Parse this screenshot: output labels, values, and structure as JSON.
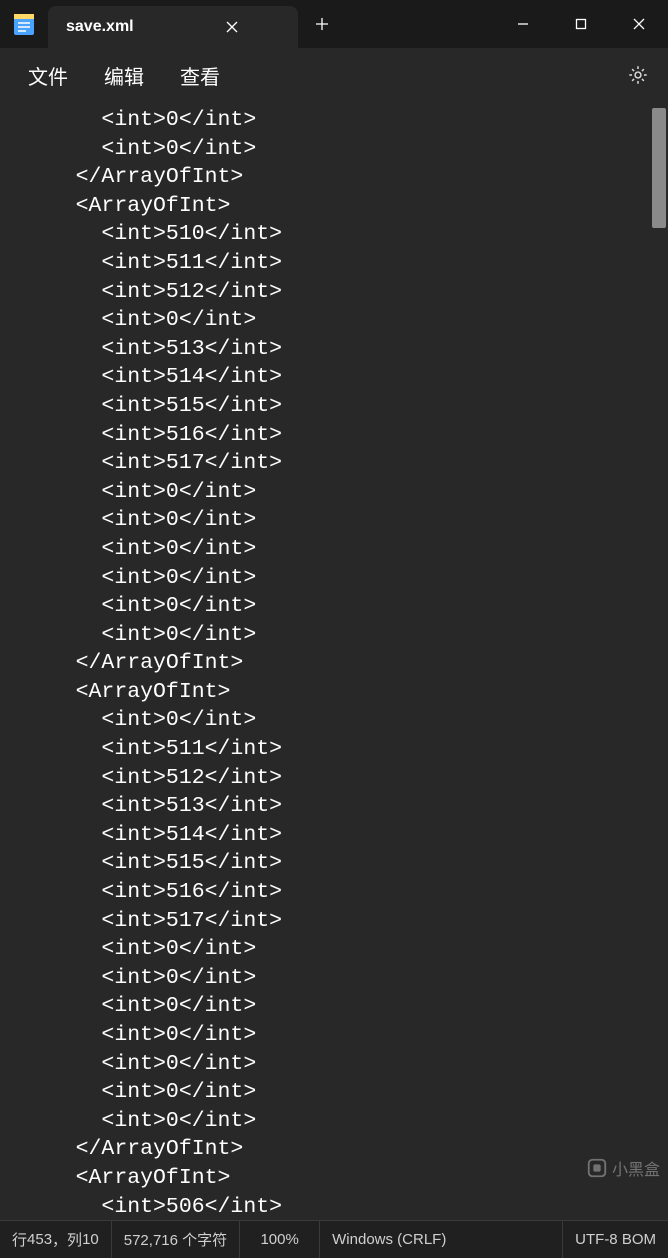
{
  "tab": {
    "title": "save.xml"
  },
  "menu": {
    "file": "文件",
    "edit": "编辑",
    "view": "查看"
  },
  "editor": {
    "lines": [
      {
        "indent": 3,
        "type": "int",
        "value": 0
      },
      {
        "indent": 3,
        "type": "int",
        "value": 0
      },
      {
        "indent": 2,
        "type": "close-array"
      },
      {
        "indent": 2,
        "type": "open-array"
      },
      {
        "indent": 3,
        "type": "int",
        "value": 510
      },
      {
        "indent": 3,
        "type": "int",
        "value": 511
      },
      {
        "indent": 3,
        "type": "int",
        "value": 512
      },
      {
        "indent": 3,
        "type": "int",
        "value": 0
      },
      {
        "indent": 3,
        "type": "int",
        "value": 513
      },
      {
        "indent": 3,
        "type": "int",
        "value": 514
      },
      {
        "indent": 3,
        "type": "int",
        "value": 515
      },
      {
        "indent": 3,
        "type": "int",
        "value": 516
      },
      {
        "indent": 3,
        "type": "int",
        "value": 517
      },
      {
        "indent": 3,
        "type": "int",
        "value": 0
      },
      {
        "indent": 3,
        "type": "int",
        "value": 0
      },
      {
        "indent": 3,
        "type": "int",
        "value": 0
      },
      {
        "indent": 3,
        "type": "int",
        "value": 0
      },
      {
        "indent": 3,
        "type": "int",
        "value": 0
      },
      {
        "indent": 3,
        "type": "int",
        "value": 0
      },
      {
        "indent": 2,
        "type": "close-array"
      },
      {
        "indent": 2,
        "type": "open-array"
      },
      {
        "indent": 3,
        "type": "int",
        "value": 0
      },
      {
        "indent": 3,
        "type": "int",
        "value": 511
      },
      {
        "indent": 3,
        "type": "int",
        "value": 512
      },
      {
        "indent": 3,
        "type": "int",
        "value": 513
      },
      {
        "indent": 3,
        "type": "int",
        "value": 514
      },
      {
        "indent": 3,
        "type": "int",
        "value": 515
      },
      {
        "indent": 3,
        "type": "int",
        "value": 516
      },
      {
        "indent": 3,
        "type": "int",
        "value": 517
      },
      {
        "indent": 3,
        "type": "int",
        "value": 0
      },
      {
        "indent": 3,
        "type": "int",
        "value": 0
      },
      {
        "indent": 3,
        "type": "int",
        "value": 0
      },
      {
        "indent": 3,
        "type": "int",
        "value": 0
      },
      {
        "indent": 3,
        "type": "int",
        "value": 0
      },
      {
        "indent": 3,
        "type": "int",
        "value": 0
      },
      {
        "indent": 3,
        "type": "int",
        "value": 0
      },
      {
        "indent": 2,
        "type": "close-array"
      },
      {
        "indent": 2,
        "type": "open-array"
      },
      {
        "indent": 3,
        "type": "int",
        "value": 506
      }
    ],
    "tags": {
      "int_open": "<int>",
      "int_close": "</int>",
      "array_open": "<ArrayOfInt>",
      "array_close": "</ArrayOfInt>"
    }
  },
  "status": {
    "position_prefix": "行 ",
    "position_line": "453",
    "position_mid": "，列 ",
    "position_col": "10",
    "chars": "572,716 个字符",
    "zoom": "100%",
    "eol": "Windows (CRLF)",
    "encoding": "UTF-8 BOM"
  },
  "watermark": "小黑盒"
}
